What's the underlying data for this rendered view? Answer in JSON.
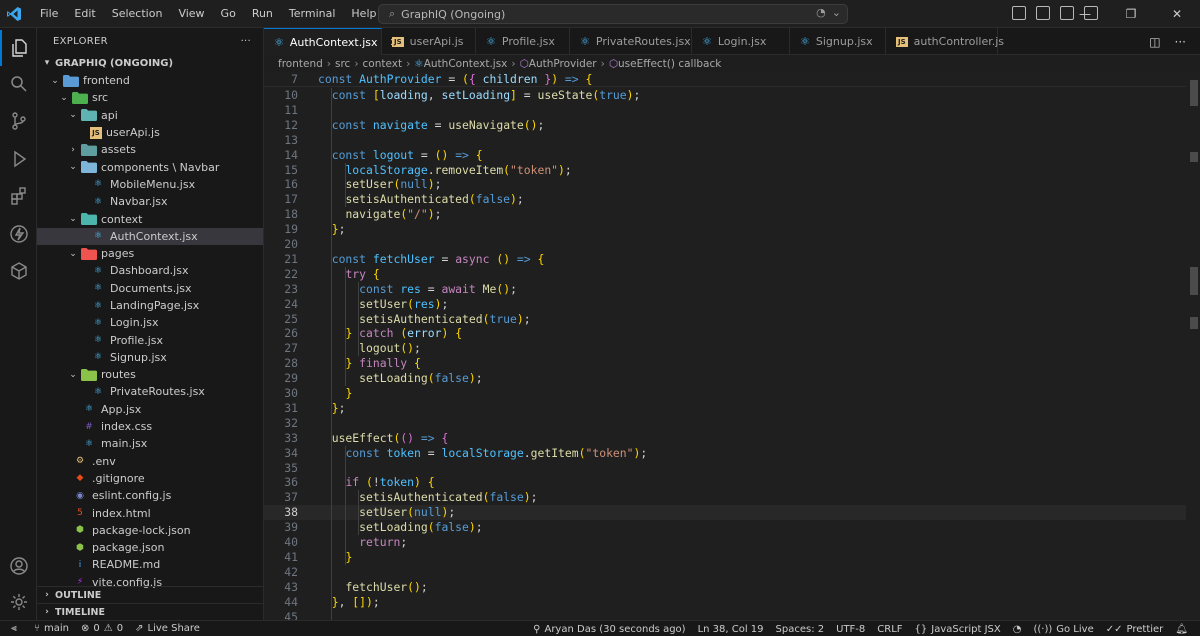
{
  "window": {
    "menu": [
      "File",
      "Edit",
      "Selection",
      "View",
      "Go",
      "Run",
      "Terminal",
      "Help"
    ],
    "search_text": "GraphIQ (Ongoing)"
  },
  "colors": {
    "accent": "#0078d4",
    "react": "#4fc1ff",
    "folder": "#dcb67a"
  },
  "sidebar": {
    "title": "EXPLORER",
    "more": "···",
    "root": "GRAPHIQ (ONGOING)",
    "tree": [
      {
        "label": "frontend",
        "type": "folder-open",
        "icon": "folder-icon",
        "color": "#5a9bd5"
      },
      {
        "label": "src",
        "type": "folder-open",
        "icon": "src-folder-icon",
        "color": "#4caf50"
      },
      {
        "label": "api",
        "type": "folder-open",
        "icon": "api-folder-icon",
        "color": "#5fb3b3"
      },
      {
        "label": "userApi.js",
        "type": "file",
        "icon": "js-file-icon",
        "color": "#e5c07b"
      },
      {
        "label": "assets",
        "type": "folder-closed",
        "icon": "assets-folder-icon",
        "color": "#5f9ea0"
      },
      {
        "label": "components \\ Navbar",
        "type": "folder-open",
        "icon": "components-folder-icon",
        "color": "#7eb6d9"
      },
      {
        "label": "MobileMenu.jsx",
        "type": "file",
        "icon": "react-file-icon",
        "color": "#4fc1ff"
      },
      {
        "label": "Navbar.jsx",
        "type": "file",
        "icon": "react-file-icon",
        "color": "#4fc1ff"
      },
      {
        "label": "context",
        "type": "folder-open",
        "icon": "context-folder-icon",
        "color": "#4db6ac"
      },
      {
        "label": "AuthContext.jsx",
        "type": "file",
        "icon": "react-file-icon",
        "color": "#4fc1ff",
        "selected": true
      },
      {
        "label": "pages",
        "type": "folder-open",
        "icon": "pages-folder-icon",
        "color": "#ef5350"
      },
      {
        "label": "Dashboard.jsx",
        "type": "file",
        "icon": "react-file-icon",
        "color": "#4fc1ff"
      },
      {
        "label": "Documents.jsx",
        "type": "file",
        "icon": "react-file-icon",
        "color": "#4fc1ff"
      },
      {
        "label": "LandingPage.jsx",
        "type": "file",
        "icon": "react-file-icon",
        "color": "#4fc1ff"
      },
      {
        "label": "Login.jsx",
        "type": "file",
        "icon": "react-file-icon",
        "color": "#4fc1ff"
      },
      {
        "label": "Profile.jsx",
        "type": "file",
        "icon": "react-file-icon",
        "color": "#4fc1ff"
      },
      {
        "label": "Signup.jsx",
        "type": "file",
        "icon": "react-file-icon",
        "color": "#4fc1ff"
      },
      {
        "label": "routes",
        "type": "folder-open",
        "icon": "routes-folder-icon",
        "color": "#8bc34a"
      },
      {
        "label": "PrivateRoutes.jsx",
        "type": "file",
        "icon": "react-file-icon",
        "color": "#4fc1ff"
      },
      {
        "label": "App.jsx",
        "type": "file",
        "icon": "react-file-icon",
        "color": "#4fc1ff"
      },
      {
        "label": "index.css",
        "type": "file",
        "icon": "css-file-icon",
        "color": "#7e57c2"
      },
      {
        "label": "main.jsx",
        "type": "file",
        "icon": "react-file-icon",
        "color": "#4fc1ff"
      },
      {
        "label": ".env",
        "type": "file",
        "icon": "env-file-icon",
        "color": "#e5c07b"
      },
      {
        "label": ".gitignore",
        "type": "file",
        "icon": "git-file-icon",
        "color": "#e64a19"
      },
      {
        "label": "eslint.config.js",
        "type": "file",
        "icon": "eslint-file-icon",
        "color": "#7986cb"
      },
      {
        "label": "index.html",
        "type": "file",
        "icon": "html-file-icon",
        "color": "#e44d26"
      },
      {
        "label": "package-lock.json",
        "type": "file",
        "icon": "npm-file-icon",
        "color": "#8bc34a"
      },
      {
        "label": "package.json",
        "type": "file",
        "icon": "npm-file-icon",
        "color": "#8bc34a"
      },
      {
        "label": "README.md",
        "type": "file",
        "icon": "info-file-icon",
        "color": "#42a5f5"
      },
      {
        "label": "vite.config.js",
        "type": "file",
        "icon": "vite-file-icon",
        "color": "#bd34fe"
      }
    ],
    "outline": "OUTLINE",
    "timeline": "TIMELINE"
  },
  "tabs": [
    {
      "label": "AuthContext.jsx",
      "active": true,
      "icon": "react-file-icon"
    },
    {
      "label": "userApi.js",
      "icon": "js-file-icon"
    },
    {
      "label": "Profile.jsx",
      "icon": "react-file-icon"
    },
    {
      "label": "PrivateRoutes.jsx",
      "icon": "react-file-icon"
    },
    {
      "label": "Login.jsx",
      "icon": "react-file-icon"
    },
    {
      "label": "Signup.jsx",
      "icon": "react-file-icon"
    },
    {
      "label": "authController.js",
      "icon": "js-file-icon"
    }
  ],
  "breadcrumb": [
    "frontend",
    "src",
    "context",
    "AuthContext.jsx",
    "AuthProvider",
    "useEffect() callback"
  ],
  "editor": {
    "sticky_line": {
      "n": "7",
      "text": "const AuthProvider = ({ children }) => {"
    },
    "current_line": "38",
    "lines": [
      {
        "n": "10",
        "text": "  const [loading, setLoading] = useState(true);"
      },
      {
        "n": "11",
        "text": ""
      },
      {
        "n": "12",
        "text": "  const navigate = useNavigate();"
      },
      {
        "n": "13",
        "text": ""
      },
      {
        "n": "14",
        "text": "  const logout = () => {"
      },
      {
        "n": "15",
        "text": "    localStorage.removeItem(\"token\");"
      },
      {
        "n": "16",
        "text": "    setUser(null);"
      },
      {
        "n": "17",
        "text": "    setisAuthenticated(false);"
      },
      {
        "n": "18",
        "text": "    navigate(\"/\");"
      },
      {
        "n": "19",
        "text": "  };"
      },
      {
        "n": "20",
        "text": ""
      },
      {
        "n": "21",
        "text": "  const fetchUser = async () => {"
      },
      {
        "n": "22",
        "text": "    try {"
      },
      {
        "n": "23",
        "text": "      const res = await Me();"
      },
      {
        "n": "24",
        "text": "      setUser(res);"
      },
      {
        "n": "25",
        "text": "      setisAuthenticated(true);"
      },
      {
        "n": "26",
        "text": "    } catch (error) {"
      },
      {
        "n": "27",
        "text": "      logout();"
      },
      {
        "n": "28",
        "text": "    } finally {"
      },
      {
        "n": "29",
        "text": "      setLoading(false);"
      },
      {
        "n": "30",
        "text": "    }"
      },
      {
        "n": "31",
        "text": "  };"
      },
      {
        "n": "32",
        "text": ""
      },
      {
        "n": "33",
        "text": "  useEffect(() => {"
      },
      {
        "n": "34",
        "text": "    const token = localStorage.getItem(\"token\");"
      },
      {
        "n": "35",
        "text": ""
      },
      {
        "n": "36",
        "text": "    if (!token) {"
      },
      {
        "n": "37",
        "text": "      setisAuthenticated(false);"
      },
      {
        "n": "38",
        "text": "      setUser(null);"
      },
      {
        "n": "39",
        "text": "      setLoading(false);"
      },
      {
        "n": "40",
        "text": "      return;"
      },
      {
        "n": "41",
        "text": "    }"
      },
      {
        "n": "42",
        "text": ""
      },
      {
        "n": "43",
        "text": "    fetchUser();"
      },
      {
        "n": "44",
        "text": "  }, []);"
      },
      {
        "n": "45",
        "text": ""
      }
    ]
  },
  "statusbar": {
    "branch": "main",
    "errors": "0",
    "warnings": "0",
    "live_share": "Live Share",
    "git_blame": "Aryan Das (30 seconds ago)",
    "position": "Ln 38, Col 19",
    "spaces": "Spaces: 2",
    "encoding": "UTF-8",
    "eol": "CRLF",
    "braces": "{}",
    "language": "JavaScript JSX",
    "go_live": "Go Live",
    "prettier": "Prettier"
  }
}
